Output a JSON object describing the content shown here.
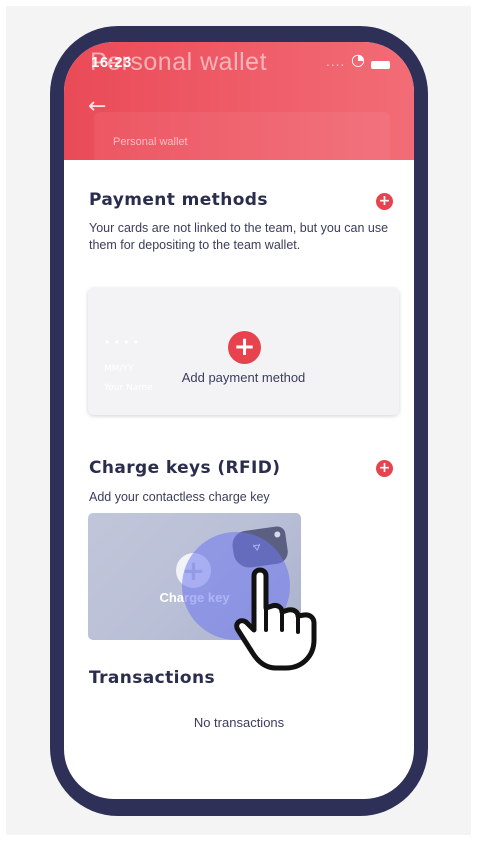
{
  "status_bar": {
    "time": "16:23",
    "signal": "....",
    "wifi_icon": "wifi-icon",
    "battery_icon": "battery-icon"
  },
  "header": {
    "title": "Personal wallet",
    "back_icon": "back-arrow-icon",
    "sub_label": "Personal wallet"
  },
  "payment_methods": {
    "title": "Payment methods",
    "add_icon": "plus-circle-icon",
    "description": "Your cards are not linked to the team, but you can use them for depositing to the team wallet.",
    "card": {
      "label": "Add payment method",
      "dots": "••••",
      "mmyy": "MM/YY",
      "name": "Your Name"
    }
  },
  "charge_keys": {
    "title": "Charge keys (RFID)",
    "add_icon": "plus-circle-icon",
    "description": "Add your contactless charge key",
    "card": {
      "label": "Charge key",
      "contactless_icon": "contactless-icon"
    }
  },
  "transactions": {
    "title": "Transactions",
    "empty_text": "No transactions"
  },
  "colors": {
    "accent": "#e6434f",
    "header": "#ef5a66",
    "frame": "#2e3057",
    "text": "#2b2d4d"
  }
}
